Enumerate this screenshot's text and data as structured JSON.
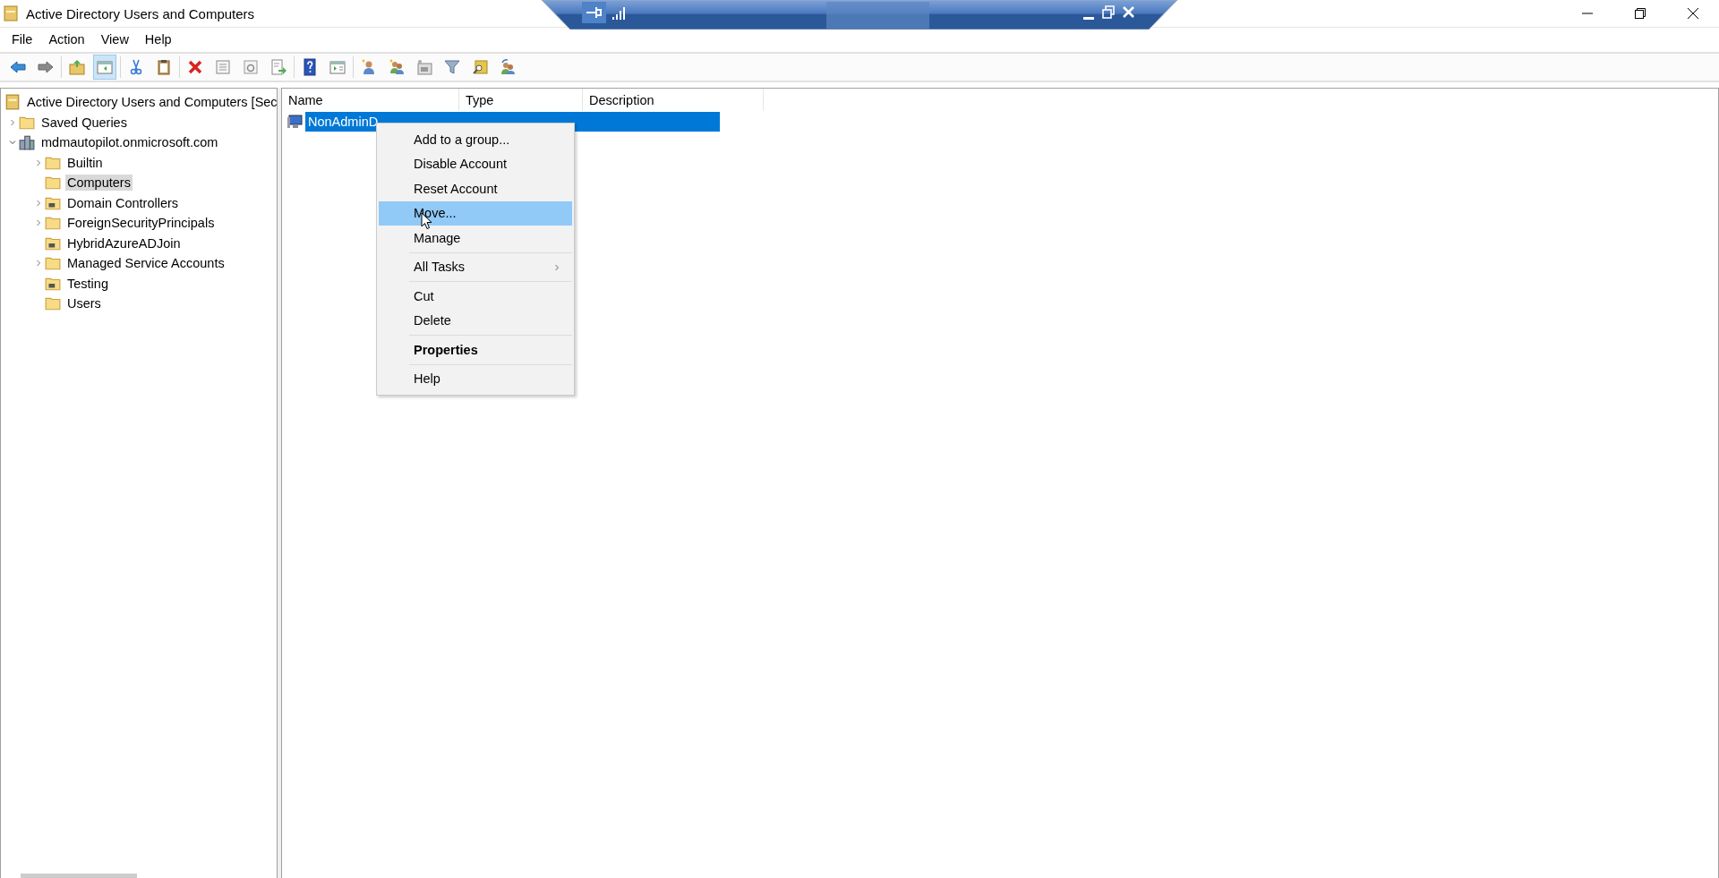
{
  "window": {
    "title": "Active Directory Users and Computers"
  },
  "menu_bar": [
    "File",
    "Action",
    "View",
    "Help"
  ],
  "toolbar": [
    {
      "buttons": [
        {
          "kind": "back",
          "pressed": false
        },
        {
          "kind": "forward",
          "pressed": false
        }
      ]
    },
    {
      "buttons": [
        {
          "kind": "up",
          "pressed": false
        },
        {
          "kind": "console-tree",
          "pressed": true
        }
      ]
    },
    {
      "buttons": [
        {
          "kind": "cut",
          "pressed": false
        },
        {
          "kind": "paste",
          "pressed": false
        }
      ]
    },
    {
      "buttons": [
        {
          "kind": "delete",
          "pressed": false
        },
        {
          "kind": "properties",
          "pressed": false
        },
        {
          "kind": "refresh",
          "pressed": false
        },
        {
          "kind": "export",
          "pressed": false
        }
      ]
    },
    {
      "buttons": [
        {
          "kind": "help",
          "pressed": false
        },
        {
          "kind": "action-pane",
          "pressed": false
        }
      ]
    },
    {
      "buttons": [
        {
          "kind": "new-user",
          "pressed": false
        },
        {
          "kind": "new-group",
          "pressed": false
        },
        {
          "kind": "new-ou",
          "pressed": false
        },
        {
          "kind": "filter",
          "pressed": false
        },
        {
          "kind": "find",
          "pressed": false
        },
        {
          "kind": "add-to-group",
          "pressed": false
        }
      ]
    }
  ],
  "tree": [
    {
      "label": "Active Directory Users and Computers [Sec",
      "kind": "snapin",
      "selected": false,
      "children": [
        {
          "label": "Saved Queries",
          "kind": "folder",
          "expandable": true,
          "expanded": false,
          "selected": false
        },
        {
          "label": "mdmautopilot.onmicrosoft.com",
          "kind": "domain",
          "expandable": true,
          "expanded": true,
          "selected": false,
          "children": [
            {
              "label": "Builtin",
              "kind": "folder",
              "expandable": true,
              "expanded": false,
              "selected": false
            },
            {
              "label": "Computers",
              "kind": "folder",
              "expandable": false,
              "selected": true
            },
            {
              "label": "Domain Controllers",
              "kind": "ou",
              "expandable": true,
              "expanded": false,
              "selected": false
            },
            {
              "label": "ForeignSecurityPrincipals",
              "kind": "folder",
              "expandable": true,
              "expanded": false,
              "selected": false
            },
            {
              "label": "HybridAzureADJoin",
              "kind": "ou",
              "expandable": false,
              "selected": false
            },
            {
              "label": "Managed Service Accounts",
              "kind": "folder",
              "expandable": true,
              "expanded": false,
              "selected": false
            },
            {
              "label": "Testing",
              "kind": "ou",
              "expandable": false,
              "selected": false
            },
            {
              "label": "Users",
              "kind": "folder",
              "expandable": false,
              "selected": false
            }
          ]
        }
      ]
    }
  ],
  "table": {
    "columns": [
      "Name",
      "Type",
      "Description"
    ],
    "rows": [
      {
        "name": "NonAdminD",
        "selected": true
      }
    ]
  },
  "context_menu": {
    "groups": [
      [
        {
          "label": "Add to a group...",
          "selected": false
        },
        {
          "label": "Disable Account",
          "selected": false
        },
        {
          "label": "Reset Account",
          "selected": false
        },
        {
          "label": "Move...",
          "selected": true
        },
        {
          "label": "Manage",
          "selected": false
        }
      ],
      [
        {
          "label": "All Tasks",
          "selected": false,
          "submenu": true
        }
      ],
      [
        {
          "label": "Cut",
          "selected": false
        },
        {
          "label": "Delete",
          "selected": false
        }
      ],
      [
        {
          "label": "Properties",
          "selected": false,
          "default": true
        }
      ],
      [
        {
          "label": "Help",
          "selected": false
        }
      ]
    ]
  }
}
